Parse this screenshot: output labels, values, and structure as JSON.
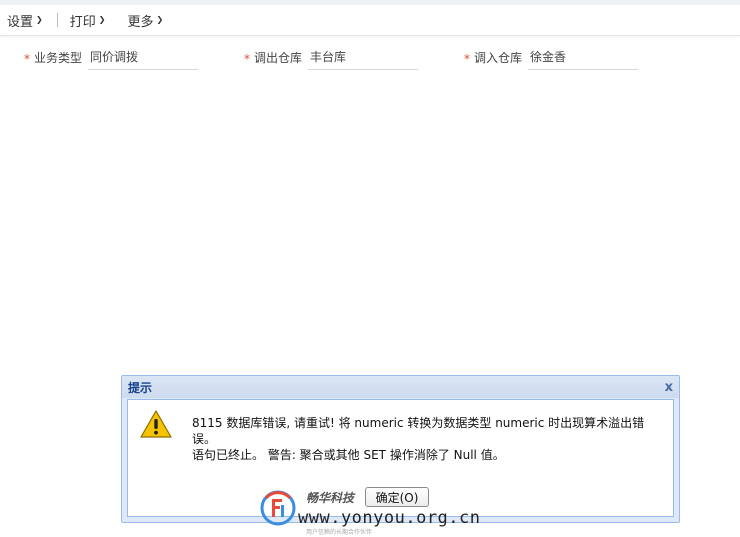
{
  "toolbar": {
    "items": [
      {
        "label": "设置"
      },
      {
        "label": "打印"
      },
      {
        "label": "更多"
      }
    ]
  },
  "form": {
    "fields": [
      {
        "required": "*",
        "label": "业务类型",
        "value": "同价调拨"
      },
      {
        "required": "*",
        "label": "调出仓库",
        "value": "丰台库"
      },
      {
        "required": "*",
        "label": "调入仓库",
        "value": "徐金香"
      }
    ]
  },
  "dialog": {
    "title": "提示",
    "close_glyph": "x",
    "message_line1": "8115 数据库错误, 请重试! 将 numeric 转换为数据类型 numeric 时出现算术溢出错误。",
    "message_line2": "语句已终止。 警告: 聚合或其他 SET 操作消除了 Null 值。",
    "ok_label": "确定(O)"
  },
  "watermark": {
    "name": "畅华科技",
    "url": "www.yonyou.org.cn",
    "slogan": "用户信赖的长期合作伙伴"
  },
  "colors": {
    "required": "#e24b3b",
    "dialog_border": "#99bbe8",
    "dialog_title_text": "#15428b",
    "warning_fill": "#f5c400"
  }
}
